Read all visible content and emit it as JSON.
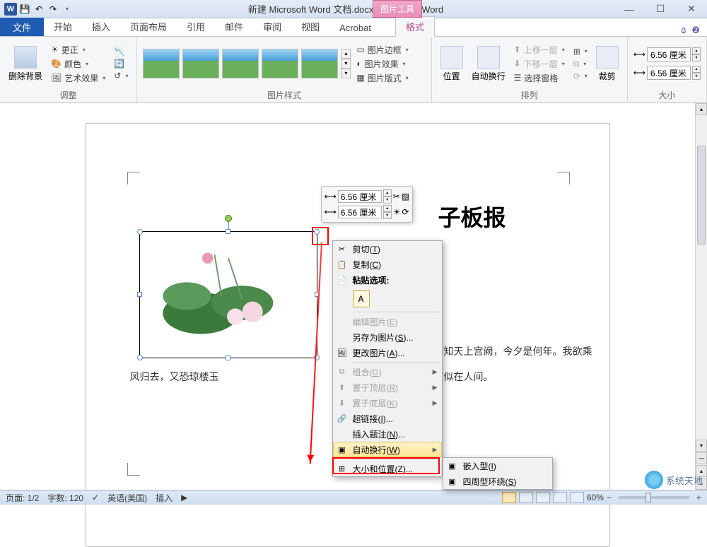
{
  "app": {
    "title": "新建 Microsoft Word 文档.docx - Microsoft Word",
    "tool_tab": "图片工具",
    "tool_subtab": "格式"
  },
  "qat": {
    "save": "save",
    "undo": "undo",
    "redo": "redo"
  },
  "win": {
    "min": "—",
    "max": "☐",
    "close": "✕"
  },
  "tabs": {
    "file": "文件",
    "items": [
      "开始",
      "插入",
      "页面布局",
      "引用",
      "邮件",
      "审阅",
      "视图",
      "Acrobat"
    ],
    "format": "格式"
  },
  "ribbon": {
    "adjust": {
      "remove_bg": "删除背景",
      "corrections": "更正",
      "color": "颜色",
      "artistic": "艺术效果",
      "label": "调整"
    },
    "styles": {
      "label": "图片样式",
      "border": "图片边框",
      "effects": "图片效果",
      "layout": "图片版式"
    },
    "arrange": {
      "position": "位置",
      "wrap": "自动换行",
      "forward": "上移一层",
      "backward": "下移一层",
      "selection": "选择窗格",
      "crop": "裁剪",
      "label": "排列"
    },
    "size": {
      "height": "6.56 厘米",
      "width": "6.56 厘米",
      "label": "大小"
    }
  },
  "floating": {
    "height": "6.56 厘米",
    "width": "6.56 厘米"
  },
  "document": {
    "title_fragment": "子板报",
    "line1_right": "青天。不知天上宫阙，今夕是何年。我欲乘",
    "line2_left": "风归去，又恐琼楼玉",
    "line2_right": "清影，何似在人间。"
  },
  "context_menu": {
    "cut": "剪切(T)",
    "copy": "复制(C)",
    "paste_header": "粘贴选项:",
    "edit_pic": "编辑图片(E)",
    "save_as_pic": "另存为图片(S)...",
    "change_pic": "更改图片(A)...",
    "group": "组合(G)",
    "bring_front": "置于顶层(R)",
    "send_back": "置于底层(K)",
    "hyperlink": "超链接(I)...",
    "caption": "插入题注(N)...",
    "wrap": "自动换行(W)",
    "size_pos": "大小和位置(Z)..."
  },
  "submenu": {
    "inline": "嵌入型(I)",
    "square": "四周型环绕(S)"
  },
  "status": {
    "page": "页面: 1/2",
    "words": "字数: 120",
    "lang": "英语(美国)",
    "mode": "插入",
    "zoom": "60%"
  },
  "watermark": "系统天地"
}
